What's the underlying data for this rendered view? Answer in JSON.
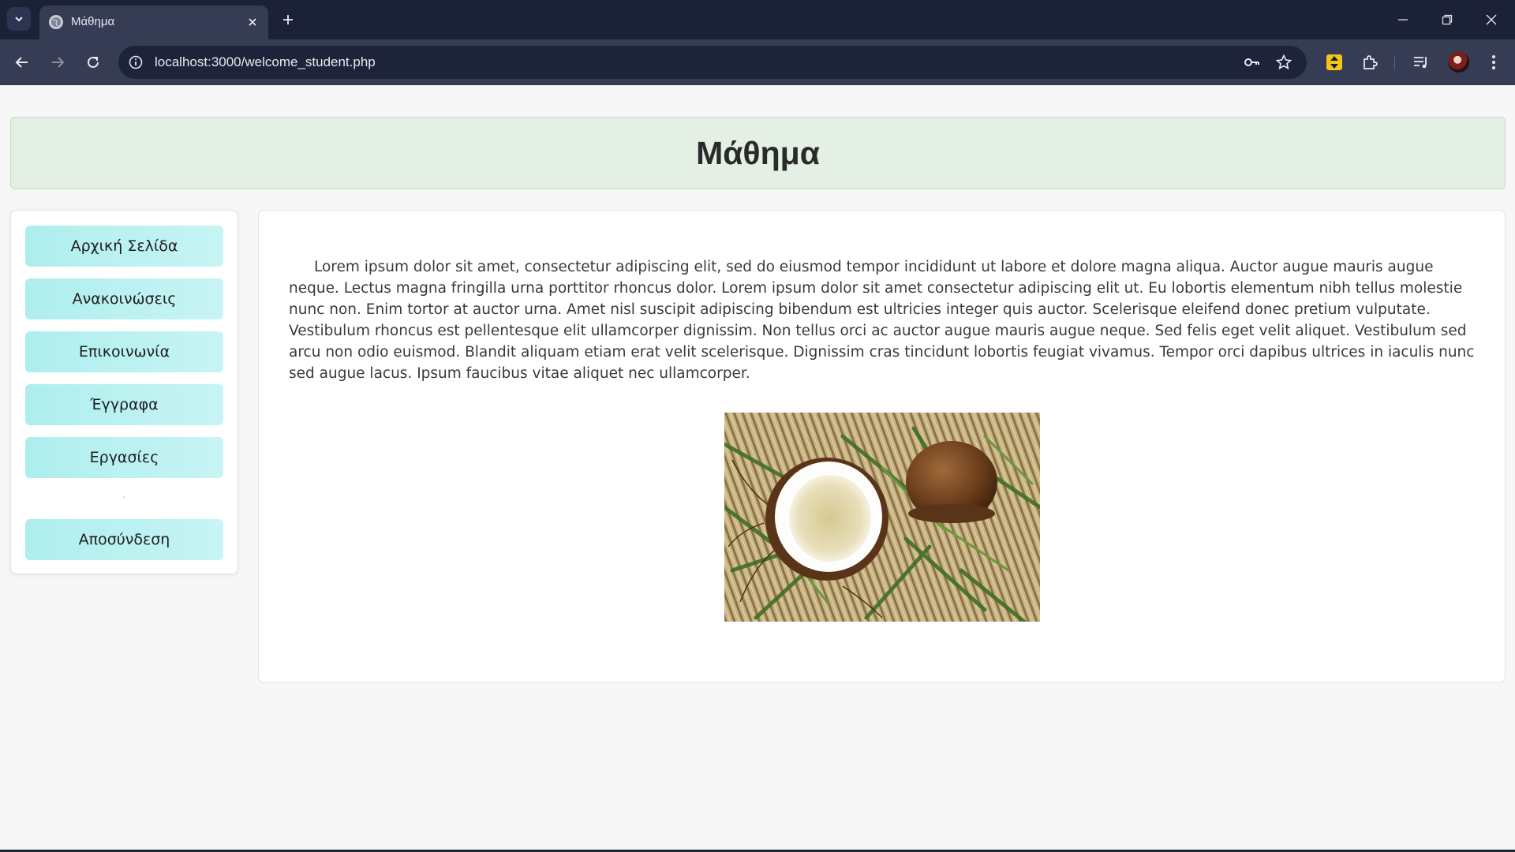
{
  "browser": {
    "tab_title": "Μάθημα",
    "url": "localhost:3000/welcome_student.php"
  },
  "page": {
    "title": "Μάθημα",
    "sidebar": {
      "items": [
        {
          "label": "Αρχική Σελίδα"
        },
        {
          "label": "Ανακοινώσεις"
        },
        {
          "label": "Επικοινωνία"
        },
        {
          "label": "Έγγραφα"
        },
        {
          "label": "Εργασίες"
        }
      ],
      "logout_label": "Αποσύνδεση"
    },
    "content": {
      "body_text": "Lorem ipsum dolor sit amet, consectetur adipiscing elit, sed do eiusmod tempor incididunt ut labore et dolore magna aliqua. Auctor augue mauris augue neque. Lectus magna fringilla urna porttitor rhoncus dolor. Lorem ipsum dolor sit amet consectetur adipiscing elit ut. Eu lobortis elementum nibh tellus molestie nunc non. Enim tortor at auctor urna. Amet nisl suscipit adipiscing bibendum est ultricies integer quis auctor. Scelerisque eleifend donec pretium vulputate. Vestibulum rhoncus est pellentesque elit ullamcorper dignissim. Non tellus orci ac auctor augue mauris augue neque. Sed felis eget velit aliquet. Vestibulum sed arcu non odio euismod. Blandit aliquam etiam erat velit scelerisque. Dignissim cras tincidunt lobortis feugiat vivamus. Tempor orci dapibus ultrices in iaculis nunc sed augue lacus. Ipsum faucibus vitae aliquet nec ullamcorper."
    }
  },
  "colors": {
    "chrome_dark": "#1b2238",
    "chrome_toolbar": "#353c54",
    "header_bg": "#e3f0e3",
    "sidebar_button": "#aeeeee"
  }
}
